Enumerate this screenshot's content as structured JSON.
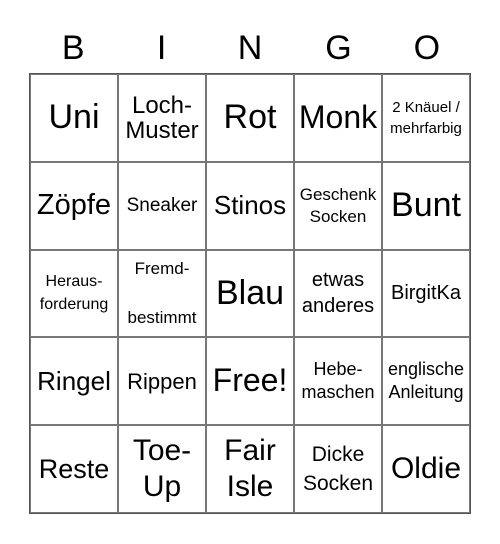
{
  "header": [
    "B",
    "I",
    "N",
    "G",
    "O"
  ],
  "cells": [
    "Uni",
    "Loch-\nMuster",
    "Rot",
    "Monk",
    "2 Knäuel /\nmehrfarbig",
    "Zöpfe",
    "Sneaker",
    "Stinos",
    "Geschenk\nSocken",
    "Bunt",
    "Heraus-\nforderung",
    "Fremd-\n\nbestimmt",
    "Blau",
    "etwas\nanderes",
    "BirgitKa",
    "Ringel",
    "Rippen",
    "Free!",
    "Hebe-\nmaschen",
    "englische\nAnleitung",
    "Reste",
    "Toe-\nUp",
    "Fair\nIsle",
    "Dicke\nSocken",
    "Oldie"
  ]
}
